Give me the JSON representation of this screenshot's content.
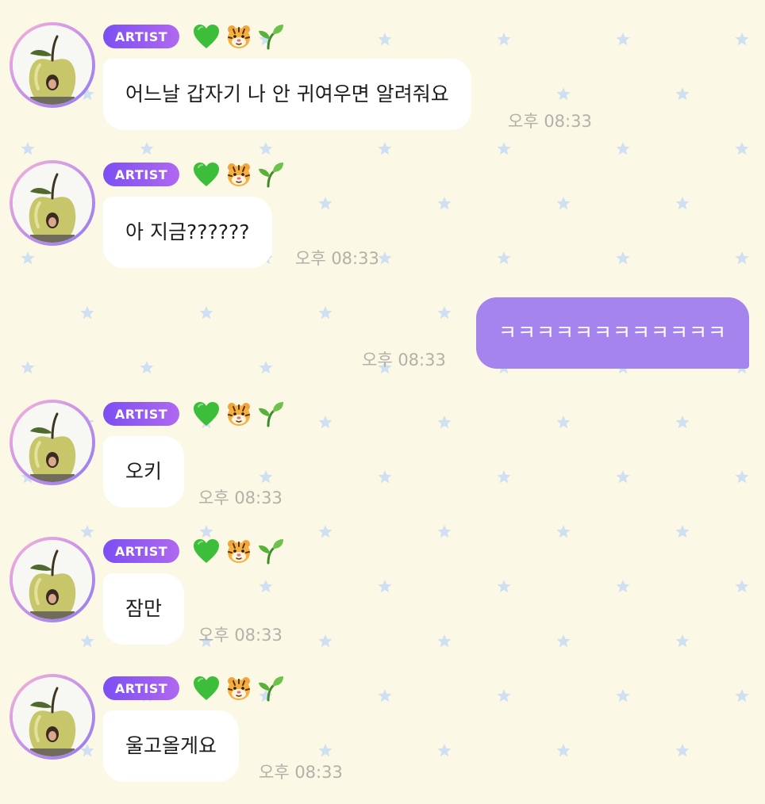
{
  "colors": {
    "background": "#fcf8e6",
    "star": "#cfe0f2",
    "incoming_bubble": "#ffffff",
    "outgoing_bubble": "#a584ee",
    "badge_gradient_start": "#7b4ff2",
    "badge_gradient_end": "#b068ef",
    "timestamp": "#b3b0a8"
  },
  "artist_badge_label": "ARTIST",
  "badge_icons": [
    "green-heart-icon",
    "tiger-face-icon",
    "seedling-icon"
  ],
  "messages": [
    {
      "sender": "artist",
      "text": "어느날 갑자기 나 안 귀여우면 알려줘요",
      "time": "오후 08:33"
    },
    {
      "sender": "artist",
      "text": "아 지금??????",
      "time": "오후 08:33"
    },
    {
      "sender": "me",
      "text": "ㅋㅋㅋㅋㅋㅋㅋㅋㅋㅋㅋㅋ",
      "time": "오후 08:33"
    },
    {
      "sender": "artist",
      "text": "오키",
      "time": "오후 08:33"
    },
    {
      "sender": "artist",
      "text": "잠만",
      "time": "오후 08:33"
    },
    {
      "sender": "artist",
      "text": "울고올게요",
      "time": "오후 08:33"
    }
  ]
}
